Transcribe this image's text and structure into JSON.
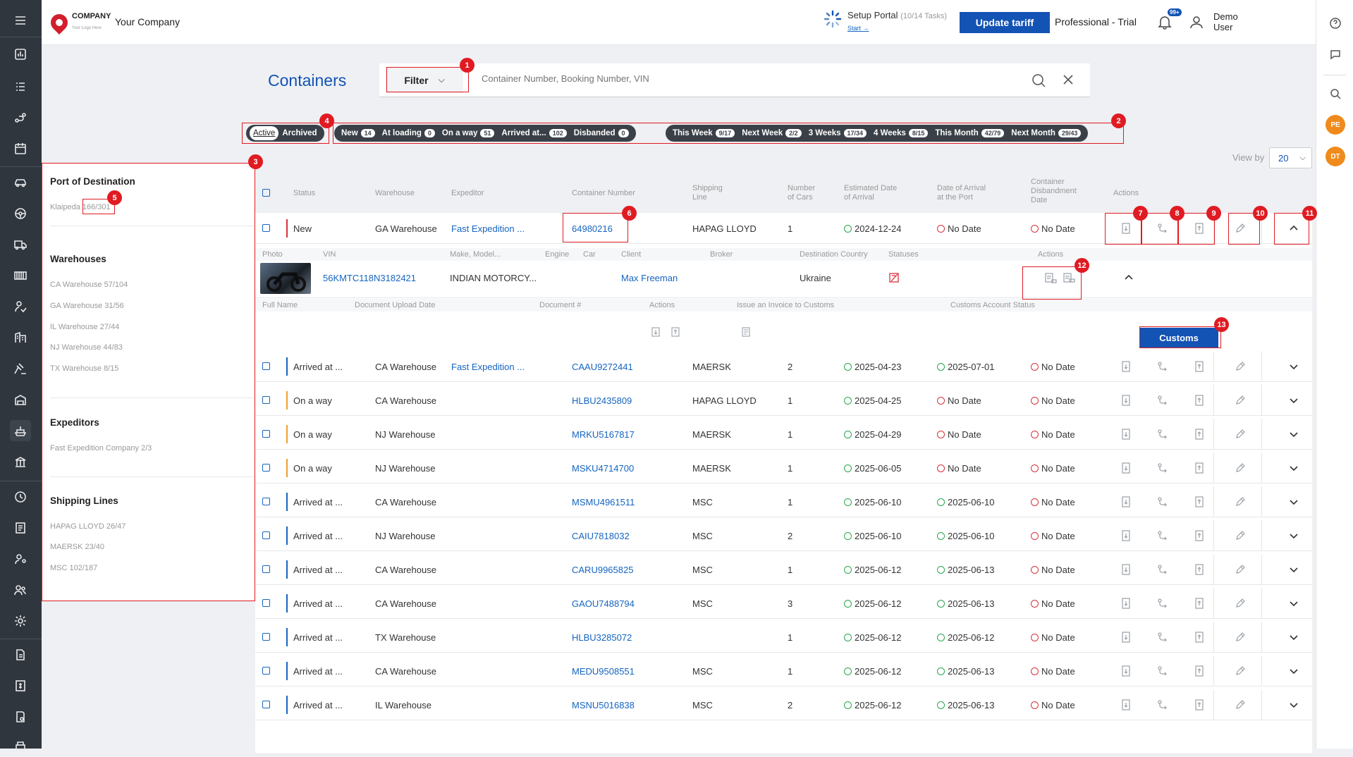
{
  "header": {
    "logo_text": "COMPANY",
    "logo_sub": "Your Logo Here",
    "company_name": "Your Company",
    "setup_title": "Setup Portal",
    "setup_progress": "(10/14 Tasks)",
    "setup_link": "Start →",
    "update_tariff": "Update tariff",
    "plan": "Professional - Trial",
    "notifications_badge": "99+",
    "user_first": "Demo",
    "user_last": "User"
  },
  "right_bar": {
    "avatar1": "PE",
    "avatar2": "DT"
  },
  "page": {
    "title": "Containers",
    "filter_label": "Filter",
    "search_placeholder": "Container Number, Booking Number, VIN"
  },
  "tabs": {
    "active": "Active",
    "archived": "Archived"
  },
  "status_pills": [
    {
      "label": "New",
      "count": "14"
    },
    {
      "label": "At loading",
      "count": "0"
    },
    {
      "label": "On a way",
      "count": "51"
    },
    {
      "label": "Arrived at...",
      "count": "102"
    },
    {
      "label": "Disbanded",
      "count": "0"
    }
  ],
  "period_pills": [
    {
      "label": "This Week",
      "count": "9/17"
    },
    {
      "label": "Next Week",
      "count": "2/2"
    },
    {
      "label": "3 Weeks",
      "count": "17/34"
    },
    {
      "label": "4 Weeks",
      "count": "8/15"
    },
    {
      "label": "This Month",
      "count": "42/79"
    },
    {
      "label": "Next Month",
      "count": "29/43"
    }
  ],
  "view_by": {
    "label": "View by",
    "value": "20"
  },
  "filters": {
    "port_title": "Port of Destination",
    "port_item": "Klaipeda 166/301",
    "warehouses_title": "Warehouses",
    "warehouses": [
      "CA Warehouse 57/104",
      "GA Warehouse 31/56",
      "IL Warehouse 27/44",
      "NJ Warehouse 44/83",
      "TX Warehouse 8/15"
    ],
    "expeditors_title": "Expeditors",
    "expeditors": [
      "Fast Expedition Company 2/3"
    ],
    "shipping_title": "Shipping Lines",
    "shipping": [
      "HAPAG LLOYD 26/47",
      "MAERSK 23/40",
      "MSC 102/187"
    ]
  },
  "table": {
    "headers": {
      "status": "Status",
      "warehouse": "Warehouse",
      "expeditor": "Expeditor",
      "container": "Container Number",
      "shipping1": "Shipping",
      "shipping2": "Line",
      "cars1": "Number",
      "cars2": "of Cars",
      "eta1": "Estimated Date",
      "eta2": "of Arrival",
      "arr1": "Date of Arrival",
      "arr2": "at the Port",
      "dis1": "Container",
      "dis2": "Disbandment",
      "dis3": "Date",
      "actions": "Actions"
    },
    "rows": [
      {
        "status": "New",
        "color": "#d8323a",
        "warehouse": "GA Warehouse",
        "expeditor": "Fast Expedition ...",
        "container": "64980216",
        "line": "HAPAG LLOYD",
        "cars": "1",
        "eta": "2024-12-24",
        "arrival": "No Date",
        "disband": "No Date",
        "arr_ok": false
      },
      {
        "status": "Arrived at ...",
        "color": "#1565c0",
        "warehouse": "CA Warehouse",
        "expeditor": "Fast Expedition ...",
        "container": "CAAU9272441",
        "line": "MAERSK",
        "cars": "2",
        "eta": "2025-04-23",
        "arrival": "2025-07-01",
        "disband": "No Date",
        "arr_ok": true
      },
      {
        "status": "On a way",
        "color": "#f0a030",
        "warehouse": "CA Warehouse",
        "expeditor": "",
        "container": "HLBU2435809",
        "line": "HAPAG LLOYD",
        "cars": "1",
        "eta": "2025-04-25",
        "arrival": "No Date",
        "disband": "No Date",
        "arr_ok": false
      },
      {
        "status": "On a way",
        "color": "#f0a030",
        "warehouse": "NJ Warehouse",
        "expeditor": "",
        "container": "MRKU5167817",
        "line": "MAERSK",
        "cars": "1",
        "eta": "2025-04-29",
        "arrival": "No Date",
        "disband": "No Date",
        "arr_ok": false
      },
      {
        "status": "On a way",
        "color": "#f0a030",
        "warehouse": "NJ Warehouse",
        "expeditor": "",
        "container": "MSKU4714700",
        "line": "MAERSK",
        "cars": "1",
        "eta": "2025-06-05",
        "arrival": "No Date",
        "disband": "No Date",
        "arr_ok": false
      },
      {
        "status": "Arrived at ...",
        "color": "#1565c0",
        "warehouse": "CA Warehouse",
        "expeditor": "",
        "container": "MSMU4961511",
        "line": "MSC",
        "cars": "1",
        "eta": "2025-06-10",
        "arrival": "2025-06-10",
        "disband": "No Date",
        "arr_ok": true
      },
      {
        "status": "Arrived at ...",
        "color": "#1565c0",
        "warehouse": "NJ Warehouse",
        "expeditor": "",
        "container": "CAIU7818032",
        "line": "MSC",
        "cars": "2",
        "eta": "2025-06-10",
        "arrival": "2025-06-10",
        "disband": "No Date",
        "arr_ok": true
      },
      {
        "status": "Arrived at ...",
        "color": "#1565c0",
        "warehouse": "CA Warehouse",
        "expeditor": "",
        "container": "CARU9965825",
        "line": "MSC",
        "cars": "1",
        "eta": "2025-06-12",
        "arrival": "2025-06-13",
        "disband": "No Date",
        "arr_ok": true
      },
      {
        "status": "Arrived at ...",
        "color": "#1565c0",
        "warehouse": "CA Warehouse",
        "expeditor": "",
        "container": "GAOU7488794",
        "line": "MSC",
        "cars": "3",
        "eta": "2025-06-12",
        "arrival": "2025-06-13",
        "disband": "No Date",
        "arr_ok": true
      },
      {
        "status": "Arrived at ...",
        "color": "#1565c0",
        "warehouse": "TX Warehouse",
        "expeditor": "",
        "container": "HLBU3285072",
        "line": "",
        "cars": "1",
        "eta": "2025-06-12",
        "arrival": "2025-06-12",
        "disband": "No Date",
        "arr_ok": true
      },
      {
        "status": "Arrived at ...",
        "color": "#1565c0",
        "warehouse": "CA Warehouse",
        "expeditor": "",
        "container": "MEDU9508551",
        "line": "MSC",
        "cars": "1",
        "eta": "2025-06-12",
        "arrival": "2025-06-13",
        "disband": "No Date",
        "arr_ok": true
      },
      {
        "status": "Arrived at ...",
        "color": "#1565c0",
        "warehouse": "IL Warehouse",
        "expeditor": "",
        "container": "MSNU5016838",
        "line": "MSC",
        "cars": "2",
        "eta": "2025-06-12",
        "arrival": "2025-06-13",
        "disband": "No Date",
        "arr_ok": true
      }
    ]
  },
  "expanded": {
    "headers": [
      "Photo",
      "VIN",
      "Make, Model...",
      "Engine",
      "Car",
      "Client",
      "Broker",
      "Destination Country",
      "Statuses",
      "Actions"
    ],
    "vin": "56KMTC118N3182421",
    "make": "INDIAN MOTORCY...",
    "client": "Max Freeman",
    "country": "Ukraine",
    "doc_headers": [
      "Full Name",
      "Document Upload Date",
      "Document #",
      "Actions",
      "Issue an Invoice to Customs",
      "Customs Account Status"
    ],
    "customs_button": "Customs"
  },
  "markers": [
    "1",
    "2",
    "3",
    "4",
    "5",
    "6",
    "7",
    "8",
    "9",
    "10",
    "11",
    "12",
    "13"
  ]
}
